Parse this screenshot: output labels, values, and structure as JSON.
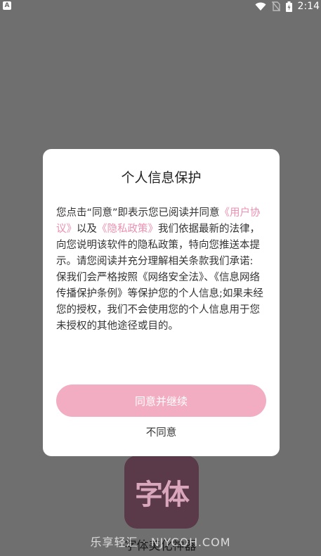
{
  "status_bar": {
    "left_icon_letter": "A",
    "time": "2:14",
    "icons": [
      "wifi-icon",
      "no-sim-icon",
      "battery-charging-icon"
    ]
  },
  "background_app": {
    "icon_text": "字体",
    "name": "字体美化神器",
    "watermark": "乐享轻汇 · NJYCOH.COM"
  },
  "dialog": {
    "title": "个人信息保护",
    "body": {
      "part1": "您点击“同意”即表示您已阅读并同意",
      "link_user_agreement": "《用户协议》",
      "part2": "以及",
      "link_privacy_policy": "《隐私政策》",
      "part3": "我们依据最新的法律，向您说明该软件的隐私政策，特向您推送本提示。请您阅读并充分理解相关条款我们承诺:",
      "part4": "保我们会严格按照《网络安全法》、《信息网络传播保护条例》等保护您的个人信息;如果未经您的授权，我们不会使用您的个人信息用于您未授权的其他途径或目的。"
    },
    "agree_button": "同意并继续",
    "disagree_button": "不同意"
  },
  "colors": {
    "overlay_background": "#6f6f6f",
    "link": "#ec8fb0",
    "primary_button": "#f2adc2"
  }
}
